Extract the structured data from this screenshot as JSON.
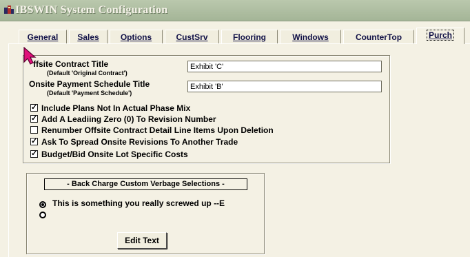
{
  "window": {
    "title": "IBSWIN System Configuration",
    "icon": "ibswin-app-icon"
  },
  "tabs": [
    {
      "label": "General",
      "underlined": true
    },
    {
      "label": "Sales",
      "underlined": true
    },
    {
      "label": "Options",
      "underlined": true
    },
    {
      "label": "CustSrv",
      "underlined": true
    },
    {
      "label": "Flooring",
      "underlined": true
    },
    {
      "label": "Windows",
      "underlined": true
    },
    {
      "label": "CounterTop",
      "underlined": false
    },
    {
      "label": "Purch",
      "underlined": true,
      "active": true
    }
  ],
  "contract": {
    "offsite_title_label": "ffsite Contract Title",
    "offsite_default": "(Default 'Original Contract')",
    "offsite_value": "Exhibit 'C'",
    "onsite_title_label": "Onsite Payment Schedule Title",
    "onsite_default": "(Default 'Payment Schedule')",
    "onsite_value": "Exhibit 'B'"
  },
  "options": [
    {
      "label": "Include Plans Not In Actual Phase Mix",
      "checked": true
    },
    {
      "label": "Add A Leadiing Zero (0) To Revision Number",
      "checked": true
    },
    {
      "label": "Renumber Offsite Contract Detail Line Items Upon Deletion",
      "checked": false
    },
    {
      "label": "Ask To Spread Onsite Revisions To Another Trade",
      "checked": true
    },
    {
      "label": "Budget/Bid Onsite Lot Specific Costs",
      "checked": true
    }
  ],
  "backcharge": {
    "legend": "- Back Charge Custom Verbage Selections -",
    "radio_options": [
      {
        "label": "This is something you really screwed up  --E",
        "selected": true
      },
      {
        "label": "",
        "selected": false
      }
    ],
    "edit_button": "Edit Text"
  },
  "colors": {
    "titlebar": "#a9b99b",
    "face": "#f4f1e4",
    "cursor": "#e0107a"
  }
}
